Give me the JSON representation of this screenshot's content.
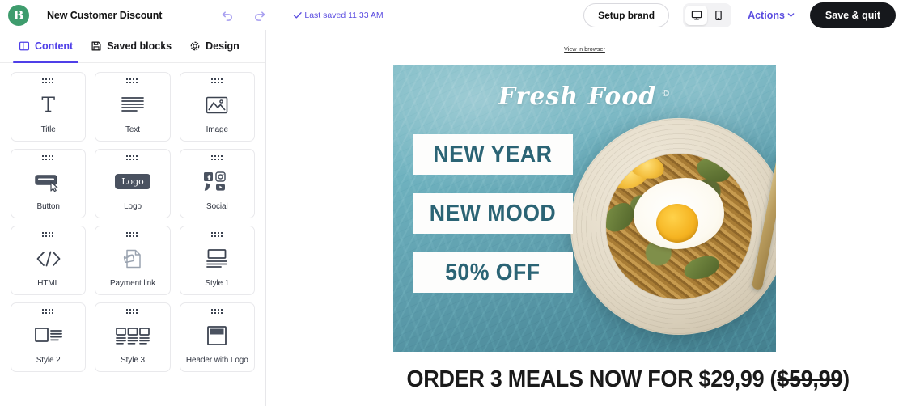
{
  "topbar": {
    "logo_letter": "B",
    "logo_color": "#3e9c6d",
    "doc_title": "New Customer Discount",
    "undo_icon": "undo-arrow-icon",
    "redo_icon": "redo-arrow-icon",
    "saved_status": "Last saved 11:33 AM",
    "saved_color": "#5b4de0",
    "setup_brand_label": "Setup brand",
    "desktop_icon": "desktop-monitor-icon",
    "mobile_icon": "mobile-phone-icon",
    "active_device": "desktop",
    "actions_label": "Actions",
    "chevron_icon": "chevron-down-icon",
    "save_quit_label": "Save & quit",
    "accent": "#5b4de0"
  },
  "sidebar": {
    "tabs": [
      {
        "label": "Content",
        "icon": "panel-layout-icon",
        "active": true
      },
      {
        "label": "Saved blocks",
        "icon": "save-disk-icon",
        "active": false
      },
      {
        "label": "Design",
        "icon": "gear-icon",
        "active": false
      }
    ],
    "blocks": [
      {
        "label": "Title",
        "icon": "title-T-icon"
      },
      {
        "label": "Text",
        "icon": "text-lines-icon"
      },
      {
        "label": "Image",
        "icon": "image-mountain-icon"
      },
      {
        "label": "Button",
        "icon": "button-cursor-icon"
      },
      {
        "label": "Logo",
        "icon": "logo-badge-icon"
      },
      {
        "label": "Social",
        "icon": "social-networks-icon"
      },
      {
        "label": "HTML",
        "icon": "code-brackets-icon"
      },
      {
        "label": "Payment link",
        "icon": "payment-card-document-icon"
      },
      {
        "label": "Style 1",
        "icon": "layout-style-1-icon"
      },
      {
        "label": "Style 2",
        "icon": "layout-style-2-icon"
      },
      {
        "label": "Style 3",
        "icon": "layout-style-3-icon"
      },
      {
        "label": "Header with Logo",
        "icon": "header-with-logo-icon"
      }
    ],
    "drag_handle_icon": "drag-dots-icon"
  },
  "canvas": {
    "view_in_browser": "View in browser",
    "hero": {
      "brand": "Fresh Food",
      "brand_reg": "©",
      "banners": [
        "NEW YEAR",
        "NEW MOOD",
        "50% OFF"
      ],
      "banner_text_color": "#2b6475",
      "background_color": "#5f9fae"
    },
    "headline_prefix": "ORDER 3 MEALS NOW FOR $29,99 (",
    "headline_strike": "$59,99",
    "headline_suffix": ")"
  }
}
